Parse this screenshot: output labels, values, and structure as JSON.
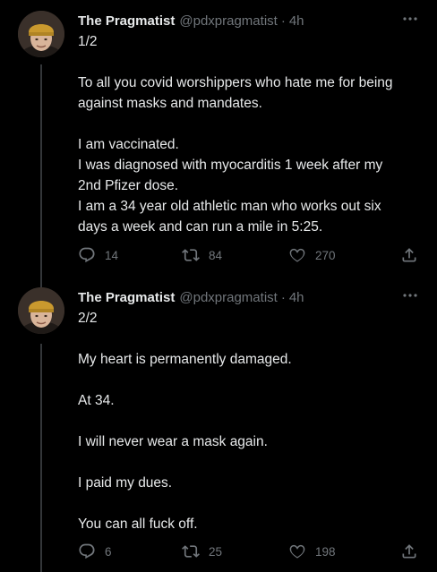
{
  "colors": {
    "background": "#000000",
    "text_primary": "#e7e9ea",
    "text_secondary": "#71767b",
    "thread_line": "#333639"
  },
  "tweets": [
    {
      "author": {
        "name": "The Pragmatist",
        "handle": "@pdxpragmatist",
        "separator": "·",
        "time": "4h"
      },
      "lines": [
        "1/2",
        "",
        "To all you covid worshippers who hate me for being",
        "against masks and mandates.",
        "",
        "I am vaccinated.",
        "I was diagnosed with myocarditis 1 week after my",
        "2nd Pfizer dose.",
        "I am a 34 year old athletic man who works out six",
        "days a week and can run a mile in 5:25."
      ],
      "actions": {
        "replies": "14",
        "retweets": "84",
        "likes": "270"
      },
      "icons": [
        "reply-icon",
        "retweet-icon",
        "like-icon",
        "share-icon",
        "more-icon"
      ]
    },
    {
      "author": {
        "name": "The Pragmatist",
        "handle": "@pdxpragmatist",
        "separator": "·",
        "time": "4h"
      },
      "lines": [
        "2/2",
        "",
        "My heart is permanently damaged.",
        "",
        "At 34.",
        "",
        "I will never wear a mask again.",
        "",
        "I paid my dues.",
        "",
        "You can all fuck off."
      ],
      "actions": {
        "replies": "6",
        "retweets": "25",
        "likes": "198"
      },
      "icons": [
        "reply-icon",
        "retweet-icon",
        "like-icon",
        "share-icon",
        "more-icon"
      ]
    }
  ]
}
